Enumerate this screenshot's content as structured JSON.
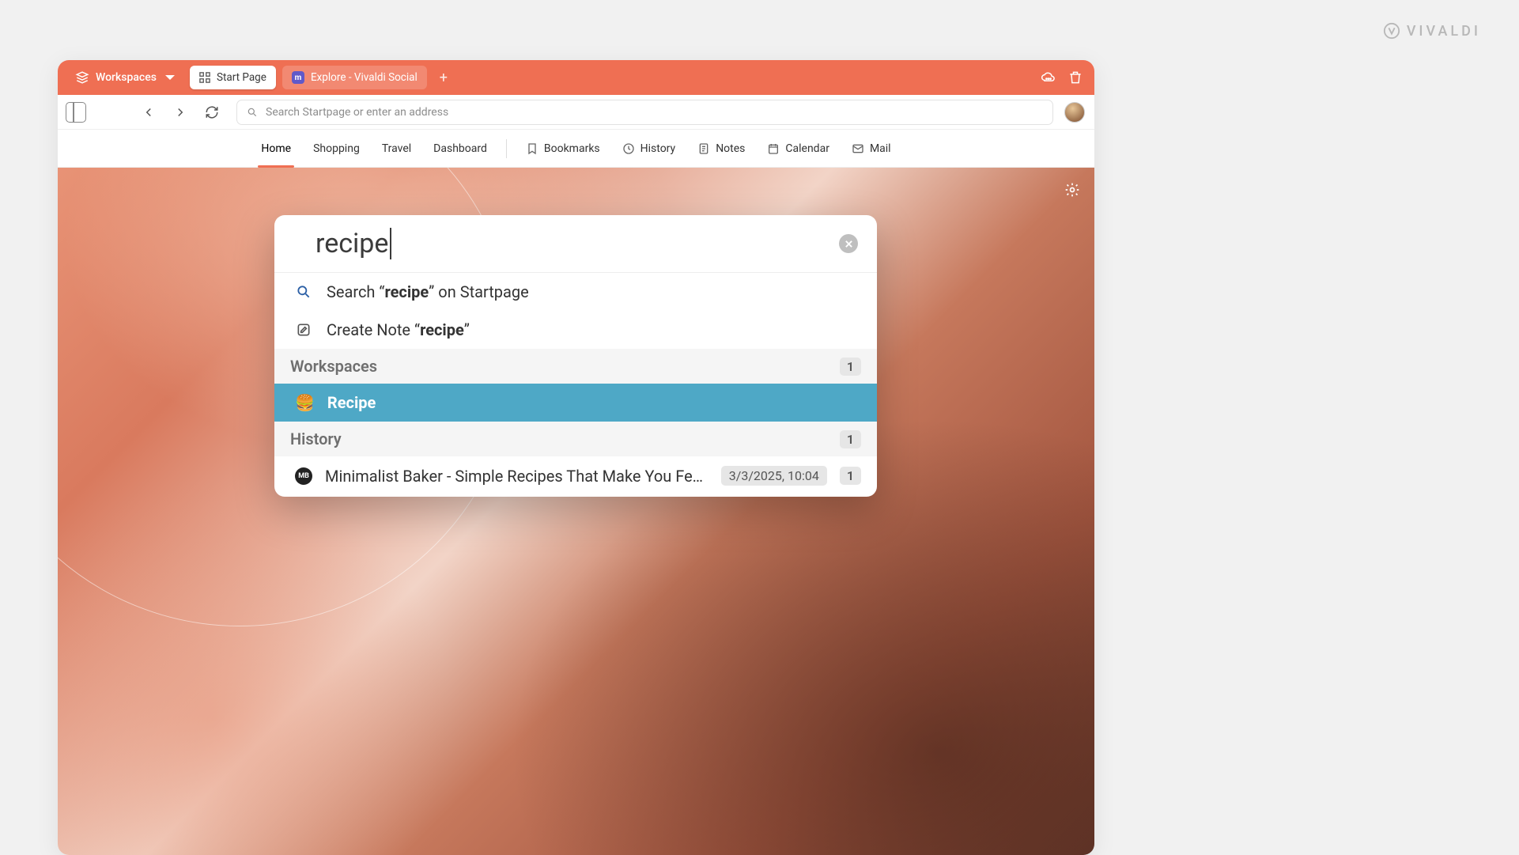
{
  "brand": "VIVALDI",
  "titlebar": {
    "workspaces_label": "Workspaces",
    "tabs": [
      {
        "label": "Start Page",
        "active": true
      },
      {
        "label": "Explore - Vivaldi Social",
        "active": false
      }
    ]
  },
  "address_bar": {
    "placeholder": "Search Startpage or enter an address"
  },
  "speeddial": {
    "items_text": [
      "Home",
      "Shopping",
      "Travel",
      "Dashboard"
    ],
    "items_icon": [
      "Bookmarks",
      "History",
      "Notes",
      "Calendar",
      "Mail"
    ]
  },
  "quick": {
    "query": "recipe",
    "search_prefix": "Search “",
    "search_bold": "recipe",
    "search_suffix": "” on Startpage",
    "note_prefix": "Create Note “",
    "note_bold": "recipe",
    "note_suffix": "”",
    "sections": {
      "workspaces": {
        "label": "Workspaces",
        "count": "1"
      },
      "history": {
        "label": "History",
        "count": "1"
      }
    },
    "workspace_item": {
      "emoji": "🍔",
      "label": "Recipe"
    },
    "history_item": {
      "favicon_text": "MB",
      "prefix": "Minimalist Baker - Simple ",
      "bold": "Recipe",
      "suffix": "s That Make You Feel …",
      "date": "3/3/2025, 10:04",
      "count": "1"
    }
  }
}
